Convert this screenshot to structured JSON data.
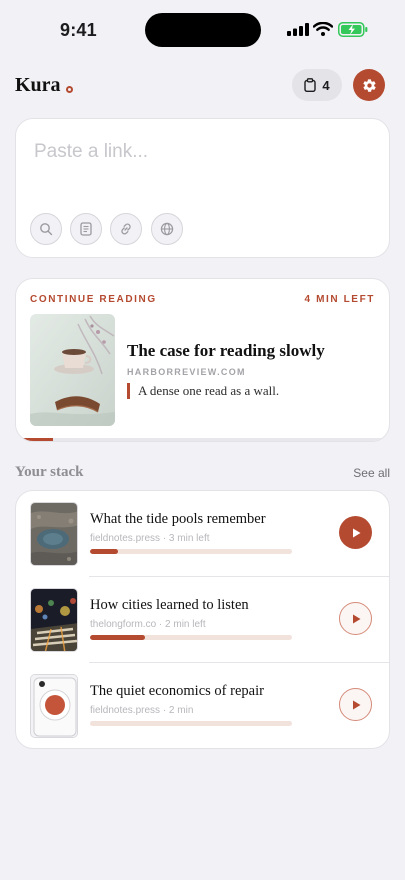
{
  "status_bar": {
    "time": "9:41"
  },
  "header": {
    "brand": "Kura",
    "stack_count": "4"
  },
  "paste": {
    "placeholder": "Paste a link..."
  },
  "continue_reading": {
    "eyebrow": "CONTINUE READING",
    "time_left": "4 MIN LEFT",
    "title": "The case for reading slowly",
    "source": "HARBORREVIEW.COM",
    "description": "A dense one read as a wall.",
    "progress": 0.1
  },
  "stack": {
    "heading": "Your stack",
    "see_all": "See all",
    "items": [
      {
        "title": "What the tide pools remember",
        "meta": "fieldnotes.press · 3 min left",
        "progress": 0.14,
        "active": true
      },
      {
        "title": "How cities learned to listen",
        "meta": "thelongform.co · 2 min left",
        "progress": 0.27,
        "active": false
      },
      {
        "title": "The quiet economics of repair",
        "meta": "fieldnotes.press · 2 min",
        "progress": 0.0,
        "active": false
      }
    ]
  },
  "colors": {
    "accent": "#b44a30",
    "background": "#f2f1f6",
    "card": "#ffffff"
  }
}
